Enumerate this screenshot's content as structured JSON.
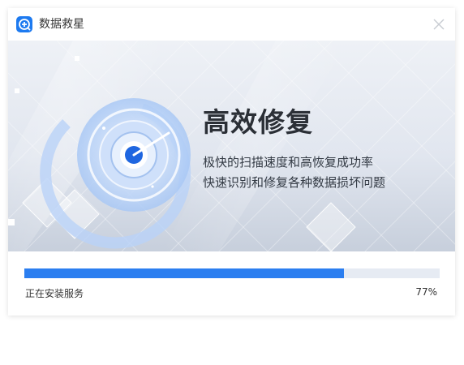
{
  "window": {
    "title": "数据救星"
  },
  "icons": {
    "app": "app-logo-icon",
    "close": "close-icon",
    "illustration": "radar-scan-illustration"
  },
  "banner": {
    "headline": "高效修复",
    "line1": "极快的扫描速度和高恢复成功率",
    "line2": "快速识别和修复各种数据损坏问题"
  },
  "progress": {
    "status": "正在安装服务",
    "percent_label": "77%",
    "value": 0.77
  },
  "colors": {
    "accent": "#2b7ef0",
    "track": "#e6ebf3",
    "title_text": "#333333",
    "headline_text": "#2b2f36"
  }
}
